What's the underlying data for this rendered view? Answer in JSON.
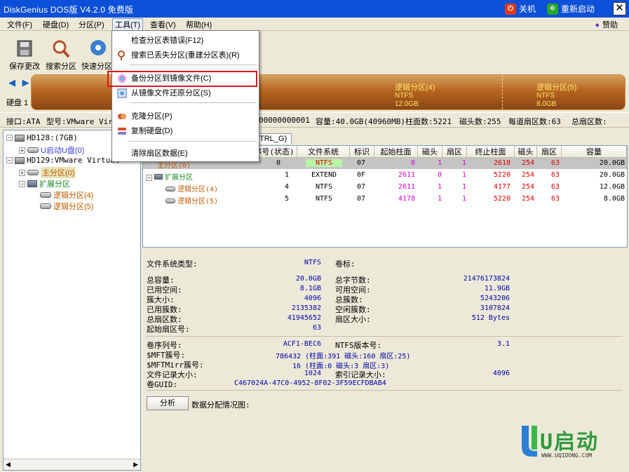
{
  "window": {
    "title": "DiskGenius DOS版 V4.2.0 免费版",
    "shutdown_label": "关机",
    "restart_label": "重新启动"
  },
  "menubar": {
    "items": [
      "文件(F)",
      "硬盘(D)",
      "分区(P)",
      "工具(T)",
      "查看(V)",
      "帮助(H)"
    ],
    "sponsor": "赞助"
  },
  "toolbar": {
    "items": [
      {
        "label": "保存更改",
        "icon": "save-icon"
      },
      {
        "label": "搜索分区",
        "icon": "search-icon"
      },
      {
        "label": "快速分区",
        "icon": "quick-partition-icon"
      }
    ]
  },
  "tools_menu": {
    "items": [
      {
        "label": "检查分区表错误(F12)",
        "icon": ""
      },
      {
        "label": "搜索已丢失分区(重建分区表)(R)",
        "icon": "search-lost-icon"
      },
      {
        "label": "备份分区到镜像文件(C)",
        "icon": "backup-image-icon"
      },
      {
        "label": "从镜像文件还原分区(S)",
        "icon": "restore-image-icon"
      },
      {
        "label": "克隆分区(P)",
        "icon": "clone-partition-icon"
      },
      {
        "label": "复制硬盘(D)",
        "icon": "copy-disk-icon"
      },
      {
        "label": "清除扇区数据(E)",
        "icon": ""
      }
    ]
  },
  "diskbar": {
    "disk_label": "硬盘 1",
    "segments": [
      {
        "name": "逻辑分区(4)",
        "fs": "NTFS",
        "size": "12.0GB"
      },
      {
        "name": "逻辑分区(5)",
        "fs": "NTFS",
        "size": "8.0GB"
      }
    ]
  },
  "diskinfo": {
    "interface": "接口:ATA",
    "model": "型号:VMware Virt",
    "serial": "00000000001",
    "capacity": "容量:40.0GB(40960MB)",
    "cylinders": "柱面数:5221",
    "heads": "磁头数:255",
    "sectors_per_track": "每道扇区数:63",
    "total_sectors": "总扇区数:"
  },
  "tree": {
    "items": [
      {
        "label": "HD128:(7GB)",
        "color": "#000000"
      },
      {
        "label": "U启动U盘(0)",
        "color": "#3b3bd4"
      },
      {
        "label": "HD129:VMware Virtual",
        "color": "#000000"
      },
      {
        "label": "主分区(0)",
        "color": "#c05c00"
      },
      {
        "label": "扩展分区",
        "color": "#1c8a1c"
      },
      {
        "label": "逻辑分区(4)",
        "color": "#c05c00"
      },
      {
        "label": "逻辑分区(5)",
        "color": "#c05c00"
      }
    ]
  },
  "tabs": {
    "visible": "TRL_G)"
  },
  "table": {
    "headers": [
      "序号(状态)",
      "文件系统",
      "标识",
      "起始柱面",
      "磁头",
      "扇区",
      "终止柱面",
      "磁头",
      "扇区",
      "容量"
    ],
    "rows": [
      {
        "name": "主分区(0)",
        "num": "0",
        "fs": "NTFS",
        "id": "07",
        "start_cyl": "0",
        "start_head": "1",
        "start_sec": "1",
        "end_cyl": "2610",
        "end_head": "254",
        "end_sec": "63",
        "size": "20.0GB"
      },
      {
        "name": "扩展分区",
        "num": "1",
        "fs": "EXTEND",
        "id": "0F",
        "start_cyl": "2611",
        "start_head": "0",
        "start_sec": "1",
        "end_cyl": "5220",
        "end_head": "254",
        "end_sec": "63",
        "size": "20.0GB"
      },
      {
        "name": "逻辑分区(4)",
        "num": "4",
        "fs": "NTFS",
        "id": "07",
        "start_cyl": "2611",
        "start_head": "1",
        "start_sec": "1",
        "end_cyl": "4177",
        "end_head": "254",
        "end_sec": "63",
        "size": "12.0GB"
      },
      {
        "name": "逻辑分区(5)",
        "num": "5",
        "fs": "NTFS",
        "id": "07",
        "start_cyl": "4178",
        "start_head": "1",
        "start_sec": "1",
        "end_cyl": "5220",
        "end_head": "254",
        "end_sec": "63",
        "size": "8.0GB"
      }
    ]
  },
  "props": {
    "fs_type_label": "文件系统类型:",
    "fs_type": "NTFS",
    "volume_label_label": "卷标:",
    "total_capacity_label": "总容量:",
    "total_capacity": "20.0GB",
    "total_bytes_label": "总字节数:",
    "total_bytes": "21476173824",
    "used_label": "已用空间:",
    "used": "8.1GB",
    "free_label": "可用空间:",
    "free": "11.9GB",
    "cluster_size_label": "簇大小:",
    "cluster_size": "4096",
    "total_clusters_label": "总簇数:",
    "total_clusters": "5243206",
    "used_clusters_label": "已用簇数:",
    "used_clusters": "2135382",
    "free_clusters_label": "空闲簇数:",
    "free_clusters": "3107824",
    "total_sectors_label": "总扇区数:",
    "total_sectors": "41945652",
    "sector_size_label": "扇区大小:",
    "sector_size": "512 Bytes",
    "start_sector_label": "起始扇区号:",
    "start_sector": "63",
    "serial_label": "卷序列号:",
    "serial": "ACF1-BEC6",
    "ntfs_ver_label": "NTFS版本号:",
    "ntfs_ver": "3.1",
    "mft_label": "$MFT簇号:",
    "mft": "786432 (柱面:391 磁头:160 扇区:25)",
    "mftmirr_label": "$MFTMirr簇号:",
    "mftmirr": "16 (柱面:0 磁头:3 扇区:3)",
    "file_record_label": "文件记录大小:",
    "file_record": "1024",
    "index_record_label": "索引记录大小:",
    "index_record": "4096",
    "guid_label": "卷GUID:",
    "guid": "C467024A-47C0-4952-8F02-3F59ECFDBAB4",
    "analyze_label": "分析",
    "data_alloc_label": "数据分配情况图:"
  },
  "logo": {
    "brand": "U启动",
    "url": "WWW.UQIDONG.COM"
  },
  "colors": {
    "titlebar": "#0c4fd8",
    "highlight_box": "#e3141c",
    "disk_bar": "#b7651f",
    "value_text": "#0000aa"
  }
}
